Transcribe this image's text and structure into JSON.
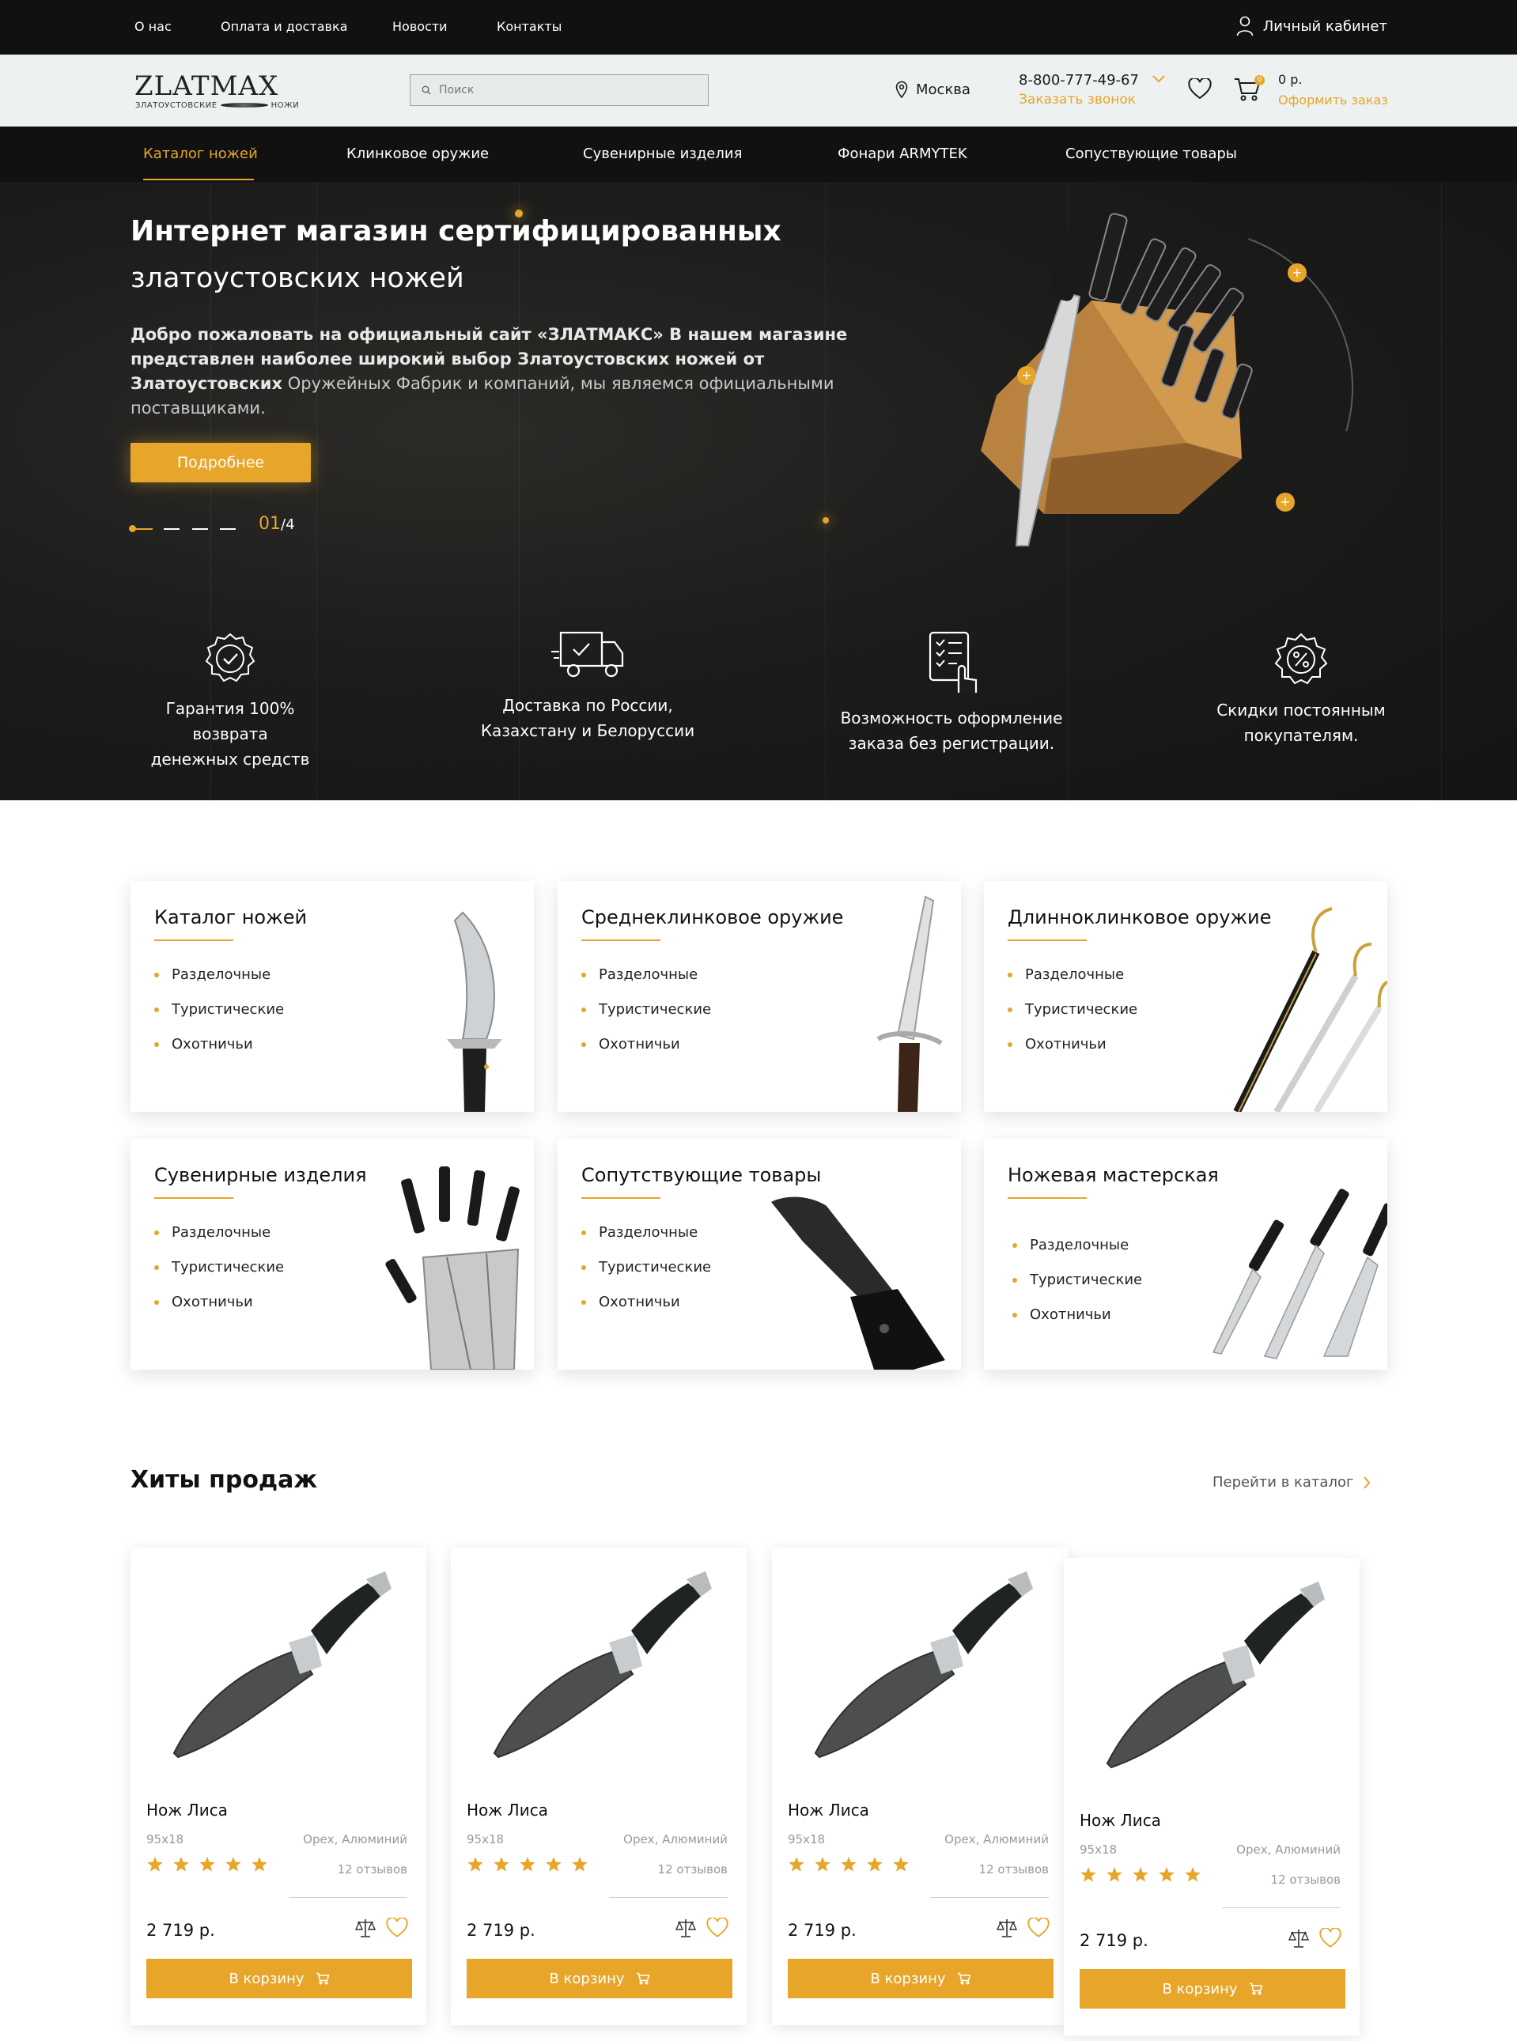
{
  "topbar": {
    "links": [
      "О нас",
      "Оплата и доставка",
      "Новости",
      "Контакты"
    ],
    "account_label": "Личный кабинет"
  },
  "header": {
    "logo": "ZLATMAX",
    "logo_sub_left": "ЗЛАТОУСТОВСКИЕ",
    "logo_sub_right": "НОЖИ",
    "search_placeholder": "Поиск",
    "city": "Москва",
    "phone": "8-800-777-49-67",
    "callback": "Заказать звонок",
    "cart_count": "0",
    "cart_sum": "0 р.",
    "checkout": "Оформить заказ"
  },
  "nav": {
    "items": [
      "Каталог ножей",
      "Клинковое оружие",
      "Сувенирные изделия",
      "Фонари ARMYTEK",
      "Сопуствующие товары"
    ],
    "active": 0
  },
  "hero": {
    "title": "Интернет магазин сертифицированных",
    "subtitle": "златоустовских ножей",
    "text_bold": "Добро пожаловать на официальный сайт «ЗЛАТМАКС» В нашем магазине представлен наиболее широкий выбор Златоустовских ножей от Златоустовских",
    "text_rest": "Оружейных Фабрик и компаний, мы являемся официальными поставщиками.",
    "button": "Подробнее",
    "slide_current": "01",
    "slide_total": "/4"
  },
  "features": [
    {
      "icon": "guarantee-check-icon",
      "line1": "Гарантия 100% возврата",
      "line2": "денежных средств"
    },
    {
      "icon": "delivery-truck-icon",
      "line1": "Доставка по России,",
      "line2": "Казахстану и Белоруссии"
    },
    {
      "icon": "checklist-order-icon",
      "line1": "Возможность оформление",
      "line2": "заказа без регистрации."
    },
    {
      "icon": "discount-badge-icon",
      "line1": "Скидки постоянным",
      "line2": "покупателям."
    }
  ],
  "categories": [
    {
      "title": "Каталог ножей",
      "items": [
        "Разделочные",
        "Туристические",
        "Охотничьи"
      ]
    },
    {
      "title": "Среднеклинковое оружие",
      "items": [
        "Разделочные",
        "Туристические",
        "Охотничьи"
      ]
    },
    {
      "title": "Длинноклинковое оружие",
      "items": [
        "Разделочные",
        "Туристические",
        "Охотничьи"
      ]
    },
    {
      "title": "Сувенирные изделия",
      "items": [
        "Разделочные",
        "Туристические",
        "Охотничьи"
      ]
    },
    {
      "title": "Сопутствующие товары",
      "items": [
        "Разделочные",
        "Туристические",
        "Охотничьи"
      ]
    },
    {
      "title": "Ножевая мастерская",
      "items": [
        "Разделочные",
        "Туристические",
        "Охотничьи"
      ]
    }
  ],
  "hits": {
    "title": "Хиты продаж",
    "to_catalog": "Перейти в каталог",
    "products": [
      {
        "name": "Нож Лиса",
        "size": "95x18",
        "material": "Орех, Алюминий",
        "rating": 5,
        "reviews": "12 отзывов",
        "price": "2 719 р.",
        "buy": "В корзину"
      },
      {
        "name": "Нож Лиса",
        "size": "95x18",
        "material": "Орех, Алюминий",
        "rating": 5,
        "reviews": "12 отзывов",
        "price": "2 719 р.",
        "buy": "В корзину"
      },
      {
        "name": "Нож Лиса",
        "size": "95x18",
        "material": "Орех, Алюминий",
        "rating": 5,
        "reviews": "12 отзывов",
        "price": "2 719 р.",
        "buy": "В корзину"
      },
      {
        "name": "Нож Лиса",
        "size": "95x18",
        "material": "Орех, Алюминий",
        "rating": 5,
        "reviews": "12 отзывов",
        "price": "2 719 р.",
        "buy": "В корзину"
      }
    ]
  },
  "colors": {
    "accent": "#e7a52a",
    "dark": "#111111",
    "header_bg": "#eef1f1"
  }
}
